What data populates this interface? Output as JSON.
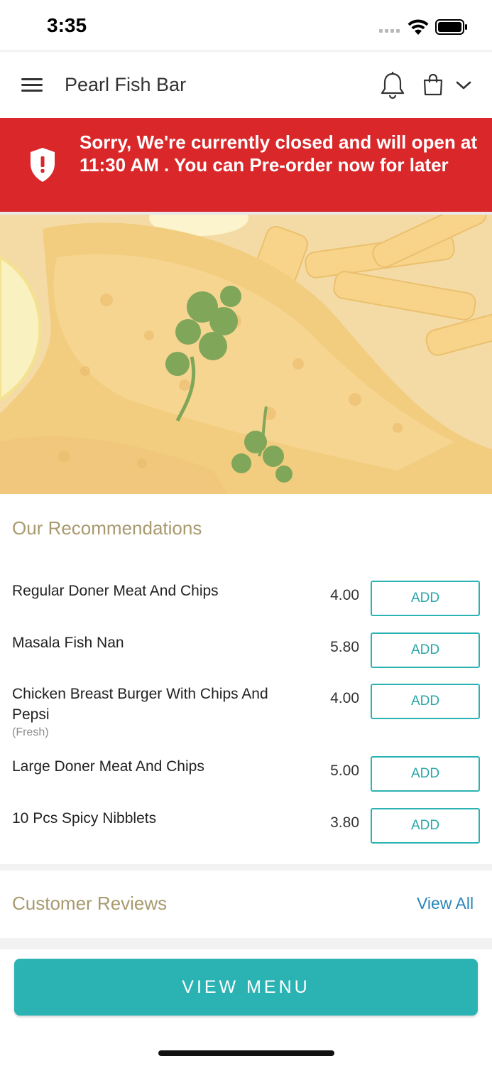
{
  "status_bar": {
    "time": "3:35"
  },
  "header": {
    "title": "Pearl Fish Bar",
    "icons": [
      "menu-icon",
      "bell-icon",
      "shopping-bag-icon",
      "chevron-down-icon"
    ]
  },
  "banner": {
    "message": "Sorry, We're currently closed and will open at 11:30 AM . You can Pre-order now for later",
    "icon": "shield-alert-icon",
    "color": "#d9272a"
  },
  "recommendations": {
    "title": "Our Recommendations",
    "items": [
      {
        "name": "Regular Doner Meat And Chips",
        "note": "",
        "price": "4.00",
        "button": "ADD"
      },
      {
        "name": "Masala Fish Nan",
        "note": "",
        "price": "5.80",
        "button": "ADD"
      },
      {
        "name": "Chicken Breast Burger With Chips And Pepsi",
        "note": "(Fresh)",
        "price": "4.00",
        "button": "ADD"
      },
      {
        "name": "Large Doner Meat And Chips",
        "note": "",
        "price": "5.00",
        "button": "ADD"
      },
      {
        "name": "10 Pcs Spicy Nibblets",
        "note": "",
        "price": "3.80",
        "button": "ADD"
      }
    ]
  },
  "reviews": {
    "title": "Customer Reviews",
    "view_all": "View All"
  },
  "footer": {
    "view_menu": "VIEW MENU"
  },
  "colors": {
    "accent": "#2bb3b3",
    "section_title": "#a89a6e",
    "link": "#2a86b8"
  }
}
